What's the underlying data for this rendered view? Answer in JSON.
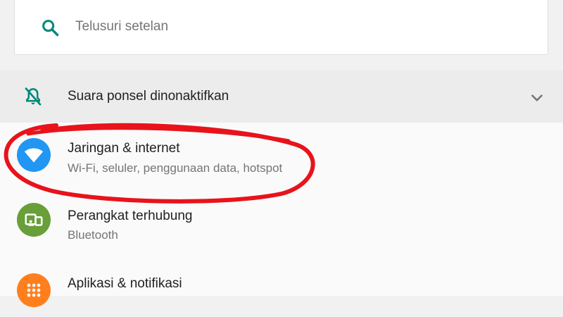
{
  "search": {
    "placeholder": "Telusuri setelan",
    "icon": "search-icon"
  },
  "suggestion": {
    "title": "Suara ponsel dinonaktifkan",
    "icon": "notifications-off-icon",
    "expand_icon": "chevron-down-icon"
  },
  "settings": [
    {
      "title": "Jaringan & internet",
      "subtitle": "Wi-Fi, seluler, penggunaan data, hotspot",
      "icon": "wifi-icon",
      "color": "#2196f3"
    },
    {
      "title": "Perangkat terhubung",
      "subtitle": "Bluetooth",
      "icon": "devices-icon",
      "color": "#689f38"
    },
    {
      "title": "Aplikasi & notifikasi",
      "subtitle": "",
      "icon": "apps-icon",
      "color": "#ff7f1e"
    }
  ],
  "colors": {
    "accent": "#00897b",
    "annotation": "#e8131b"
  }
}
